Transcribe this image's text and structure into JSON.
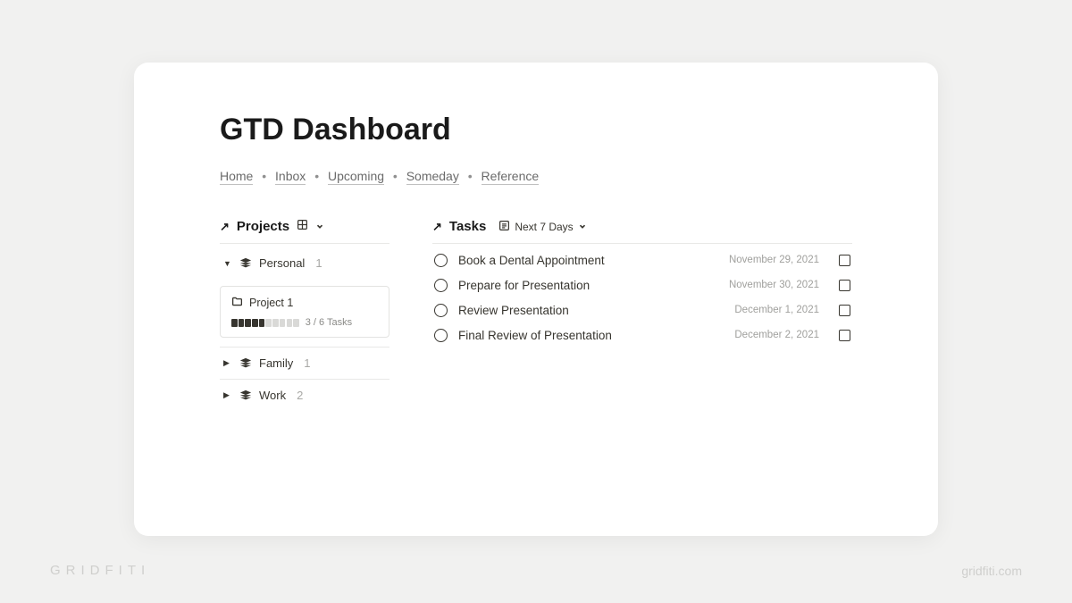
{
  "page": {
    "title": "GTD Dashboard"
  },
  "breadcrumb": {
    "items": [
      "Home",
      "Inbox",
      "Upcoming",
      "Someday",
      "Reference"
    ]
  },
  "projects": {
    "heading": "Projects",
    "groups": [
      {
        "name": "Personal",
        "count": "1",
        "expanded": true
      },
      {
        "name": "Family",
        "count": "1",
        "expanded": false
      },
      {
        "name": "Work",
        "count": "2",
        "expanded": false
      }
    ],
    "card": {
      "title": "Project 1",
      "progress_filled": 5,
      "progress_total": 10,
      "progress_label": "3 / 6 Tasks"
    }
  },
  "tasks": {
    "heading": "Tasks",
    "view_label": "Next 7 Days",
    "items": [
      {
        "title": "Book a Dental Appointment",
        "date": "November 29, 2021"
      },
      {
        "title": "Prepare for Presentation",
        "date": "November 30, 2021"
      },
      {
        "title": "Review Presentation",
        "date": "December 1, 2021"
      },
      {
        "title": "Final Review of Presentation",
        "date": "December 2, 2021"
      }
    ]
  },
  "watermark": {
    "left": "GRIDFITI",
    "right": "gridfiti.com"
  }
}
